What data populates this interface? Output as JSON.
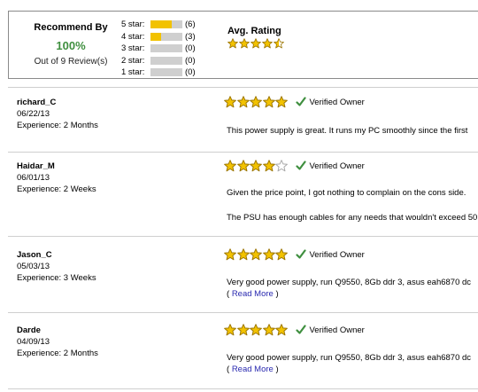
{
  "summary": {
    "recommend_title": "Recommend By",
    "recommend_percent": "100%",
    "recommend_sub": "Out of 9 Review(s)",
    "distribution": [
      {
        "label": "5 star:",
        "count": "(6)",
        "fraction": 0.667
      },
      {
        "label": "4 star:",
        "count": "(3)",
        "fraction": 0.333
      },
      {
        "label": "3 star:",
        "count": "(0)",
        "fraction": 0
      },
      {
        "label": "2 star:",
        "count": "(0)",
        "fraction": 0
      },
      {
        "label": "1 star:",
        "count": "(0)",
        "fraction": 0
      }
    ],
    "avg_title": "Avg. Rating",
    "avg_rating": 4.5
  },
  "colors": {
    "star": "#f2c200",
    "star_outline": "#9a7400",
    "check": "#3f8f3f",
    "bar_fill": "#f2c200",
    "bar_bg": "#cfcfcf"
  },
  "reviews": [
    {
      "name": "richard_C",
      "date": "06/22/13",
      "experience": "Experience: 2 Months",
      "rating": 5,
      "verified": "Verified Owner",
      "lines": [
        "This power supply is great. It runs my PC smoothly since the first"
      ],
      "read_more": ""
    },
    {
      "name": "Haidar_M",
      "date": "06/01/13",
      "experience": "Experience: 2 Weeks",
      "rating": 4,
      "verified": "Verified Owner",
      "lines": [
        "Given the price point, I got nothing to complain on the cons side.",
        "The PSU has enough cables for any needs that wouldn't exceed 50"
      ],
      "read_more": ""
    },
    {
      "name": "Jason_C",
      "date": "05/03/13",
      "experience": "Experience: 3 Weeks",
      "rating": 5,
      "verified": "Verified Owner",
      "lines": [
        "Very good power supply, run Q9550, 8Gb ddr 3, asus eah6870 dc"
      ],
      "read_more": "Read More"
    },
    {
      "name": "Darde",
      "date": "04/09/13",
      "experience": "Experience: 2 Months",
      "rating": 5,
      "verified": "Verified Owner",
      "lines": [
        "Very good power supply, run Q9550, 8Gb ddr 3, asus eah6870 dc"
      ],
      "read_more": "Read More"
    }
  ]
}
